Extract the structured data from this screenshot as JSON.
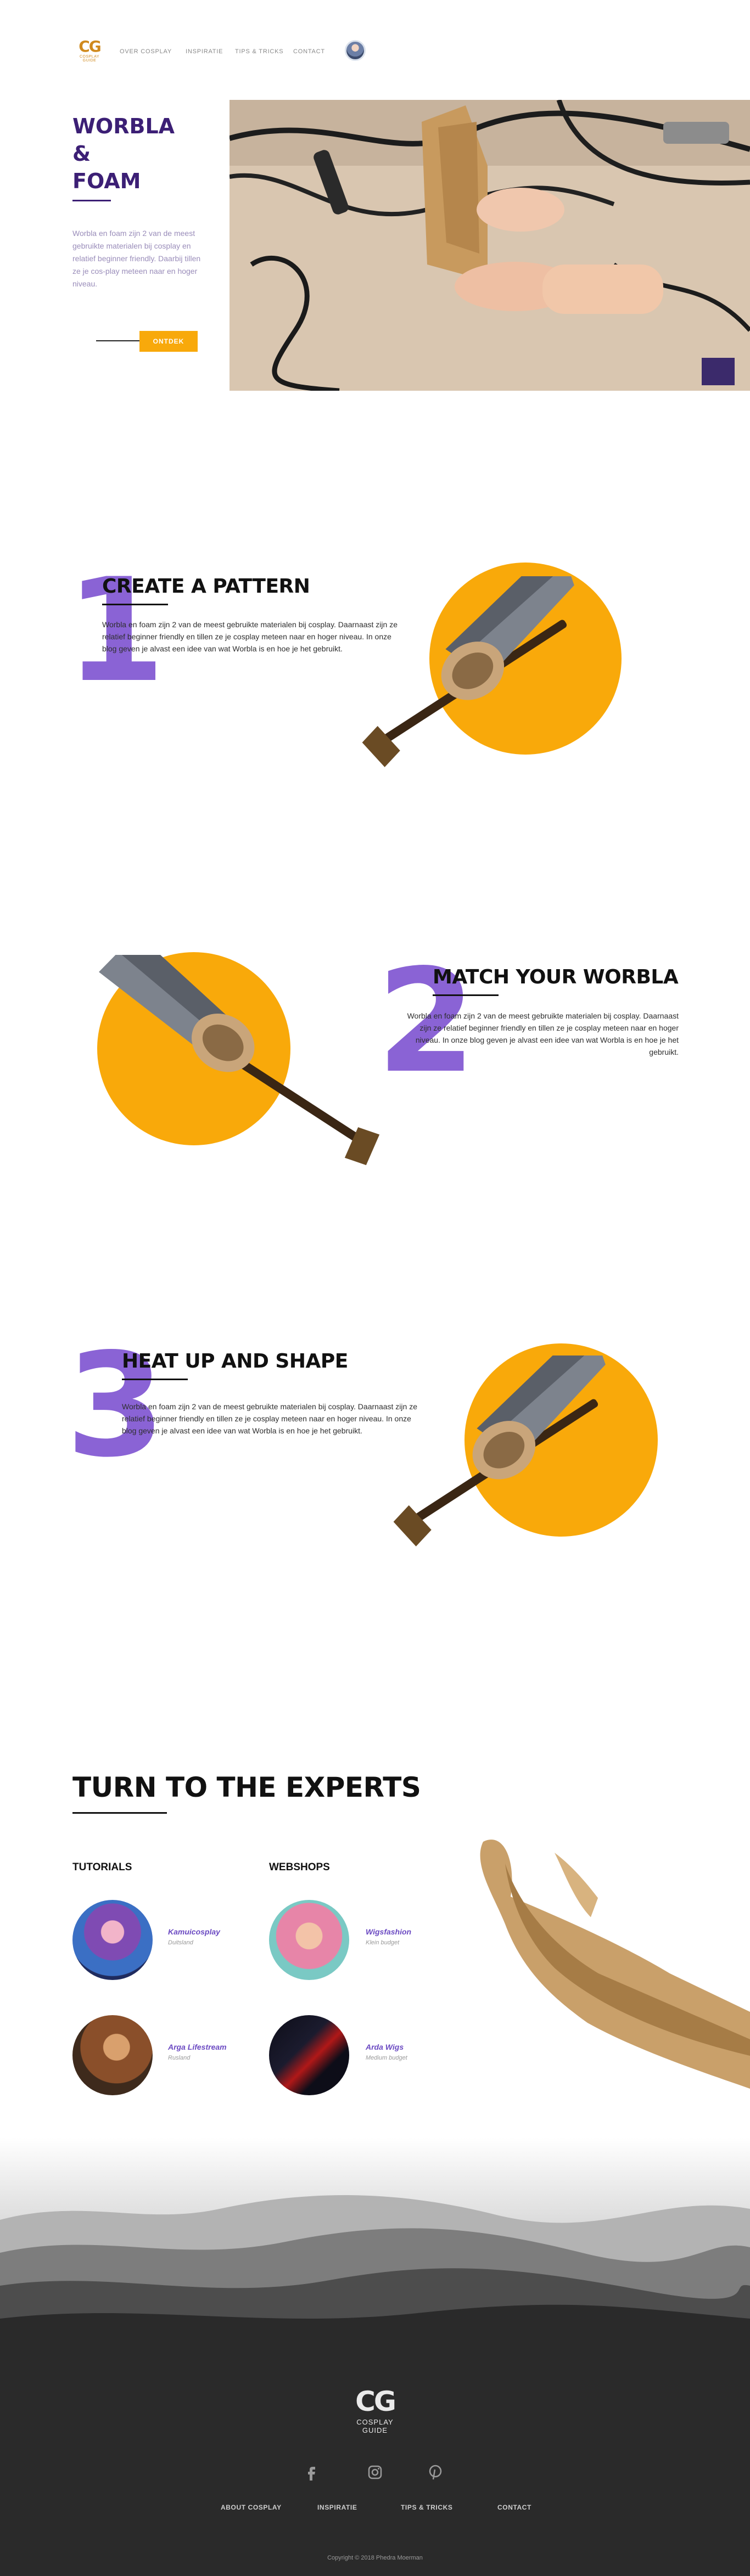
{
  "header": {
    "logo_mark": "CG",
    "logo_sub": "COSPLAY GUIDE",
    "nav": [
      "OVER COSPLAY",
      "INSPIRATIE",
      "TIPS & TRICKS",
      "CONTACT"
    ]
  },
  "hero": {
    "title_line1": "WORBLA",
    "title_line2": "&",
    "title_line3": "FOAM",
    "text": "Worbla en foam zijn 2 van de meest gebruikte materialen bij cosplay en relatief beginner friendly. Daarbij tillen ze je cos-play meteen naar en hoger niveau.",
    "cta_label": "ONTDEK"
  },
  "steps": [
    {
      "number": "1",
      "title": "CREATE A PATTERN",
      "text": "Worbla en foam zijn 2 van de meest gebruikte materialen bij cosplay. Daarnaast zijn ze relatief beginner friendly en tillen ze je cosplay meteen naar en hoger niveau. In onze blog geven je alvast een idee van wat Worbla is en hoe je het gebruikt."
    },
    {
      "number": "2",
      "title": "MATCH YOUR WORBLA",
      "text": "Worbla en foam zijn 2 van de meest gebruikte materialen bij cosplay. Daarnaast zijn ze relatief beginner friendly en tillen ze je cosplay meteen naar en hoger niveau. In onze blog geven je alvast een idee van wat Worbla is en hoe je het gebruikt."
    },
    {
      "number": "3",
      "title": "HEAT UP AND SHAPE",
      "text": "Worbla en foam zijn 2 van de meest gebruikte materialen bij cosplay. Daarnaast zijn ze relatief beginner friendly en tillen ze je cosplay meteen naar en hoger niveau. In onze blog geven je alvast een idee van wat Worbla is en hoe je het gebruikt."
    }
  ],
  "experts": {
    "title": "TURN TO THE EXPERTS",
    "tutorials_heading": "TUTORIALS",
    "webshops_heading": "WEBSHOPS",
    "tutorials": [
      {
        "name": "Kamuicosplay",
        "sub": "Duitsland"
      },
      {
        "name": "Arga Lifestream",
        "sub": "Rusland"
      }
    ],
    "webshops": [
      {
        "name": "Wigsfashion",
        "sub": "Klein budget"
      },
      {
        "name": "Arda Wigs",
        "sub": "Medium budget"
      }
    ]
  },
  "footer": {
    "logo_mark": "CG",
    "logo_sub": "COSPLAY GUIDE",
    "social": [
      "facebook-icon",
      "instagram-icon",
      "pinterest-icon"
    ],
    "nav": [
      "ABOUT COSPLAY",
      "INSPIRATIE",
      "TIPS & TRICKS",
      "CONTACT"
    ],
    "copyright": "Copyright © 2018 Phedra Moerman"
  },
  "colors": {
    "accent": "#f8a90b",
    "purple": "#3c1f75",
    "number_purple": "#8a63d5",
    "footer_bg": "#2a2a2a"
  }
}
